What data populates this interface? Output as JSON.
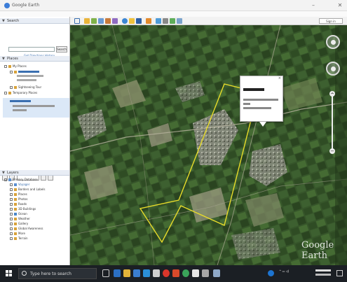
{
  "window": {
    "title": "Google Earth",
    "minimize": "–",
    "close": "✕"
  },
  "sidebar": {
    "search_header": "Search",
    "search_button": "Search",
    "get_directions": "Get Directions   History",
    "places_header": "Places",
    "my_places": "My Places",
    "sightseeing_tour": "Sightseeing Tour",
    "temporary_places": "Temporary Places",
    "layers_header": "Layers",
    "primary_database": "Primary Database",
    "layer_items": [
      "Voyager",
      "Borders and Labels",
      "Places",
      "Photos",
      "Roads",
      "3D Buildings",
      "Ocean",
      "Weather",
      "Gallery",
      "Global Awareness",
      "More",
      "Terrain"
    ]
  },
  "toolbar": {
    "sign_in": "Sign in"
  },
  "watermark": "Google Earth",
  "taskbar": {
    "search_placeholder": "Type here to search"
  },
  "colors": {
    "boundary": "#e8dc2a",
    "taskbar": "#1b1f24",
    "selection": "#dbe8f7"
  }
}
